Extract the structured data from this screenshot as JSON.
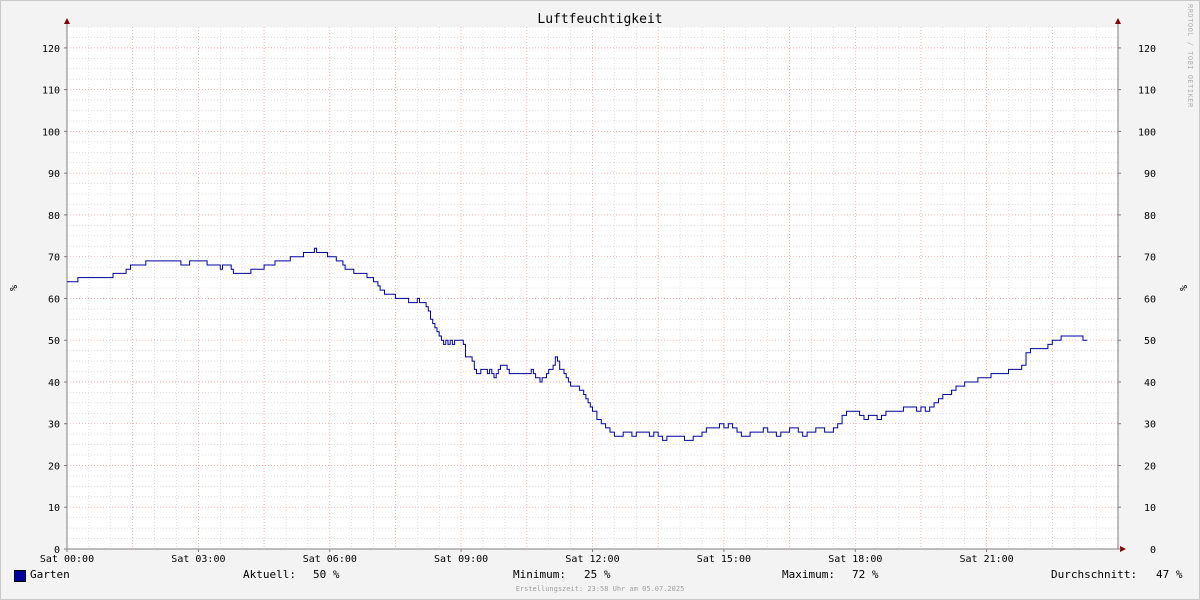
{
  "chart_data": {
    "type": "line",
    "title": "Luftfeuchtigkeit",
    "ylabel": "%",
    "ylim": [
      0,
      125
    ],
    "y_ticks": [
      0,
      10,
      20,
      30,
      40,
      50,
      60,
      70,
      80,
      90,
      100,
      110,
      120
    ],
    "x_tick_labels": [
      "Sat 00:00",
      "Sat 03:00",
      "Sat 06:00",
      "Sat 09:00",
      "Sat 12:00",
      "Sat 15:00",
      "Sat 18:00",
      "Sat 21:00"
    ],
    "x_tick_hours": [
      0,
      3,
      6,
      9,
      12,
      15,
      18,
      21
    ],
    "xlim_hours": [
      0,
      24
    ],
    "grid": true,
    "colors": {
      "series": "#0000a0",
      "major_grid": "#f0a0a0",
      "minor_grid": "#d0d0d0",
      "axis": "#800000"
    },
    "series": [
      {
        "name": "Garten",
        "x_hours": [
          0,
          0.2,
          0.25,
          0.6,
          1.0,
          1.05,
          1.3,
          1.35,
          1.45,
          1.75,
          1.8,
          2.3,
          2.55,
          2.6,
          2.75,
          2.8,
          3.15,
          3.2,
          3.35,
          3.45,
          3.5,
          3.55,
          3.75,
          3.8,
          4.2,
          4.25,
          4.5,
          4.55,
          4.75,
          4.8,
          5.1,
          5.15,
          5.4,
          5.45,
          5.65,
          5.7,
          5.9,
          5.95,
          6.15,
          6.2,
          6.3,
          6.35,
          6.5,
          6.55,
          6.65,
          6.7,
          6.85,
          6.9,
          7.0,
          7.05,
          7.1,
          7.15,
          7.25,
          7.35,
          7.45,
          7.5,
          7.6,
          7.65,
          7.75,
          7.8,
          8.0,
          8.05,
          8.15,
          8.2,
          8.25,
          8.3,
          8.35,
          8.4,
          8.45,
          8.5,
          8.55,
          8.6,
          8.65,
          8.7,
          8.75,
          8.8,
          8.85,
          8.9,
          8.95,
          9.0,
          9.05,
          9.1,
          9.15,
          9.2,
          9.25,
          9.3,
          9.35,
          9.4,
          9.45,
          9.5,
          9.55,
          9.6,
          9.65,
          9.7,
          9.75,
          9.8,
          9.85,
          9.9,
          9.95,
          10.0,
          10.05,
          10.1,
          10.15,
          10.2,
          10.25,
          10.3,
          10.35,
          10.4,
          10.45,
          10.5,
          10.55,
          10.6,
          10.65,
          10.7,
          10.75,
          10.8,
          10.85,
          10.9,
          10.95,
          11.0,
          11.05,
          11.1,
          11.15,
          11.2,
          11.25,
          11.3,
          11.35,
          11.4,
          11.45,
          11.5,
          11.55,
          11.6,
          11.65,
          11.7,
          11.75,
          11.8,
          11.85,
          11.9,
          11.95,
          12.0,
          12.1,
          12.2,
          12.3,
          12.4,
          12.5,
          12.6,
          12.7,
          12.8,
          12.9,
          13.0,
          13.1,
          13.2,
          13.3,
          13.4,
          13.5,
          13.6,
          13.7,
          13.8,
          13.9,
          14.0,
          14.1,
          14.2,
          14.3,
          14.4,
          14.5,
          14.6,
          14.7,
          14.8,
          14.9,
          15.0,
          15.1,
          15.2,
          15.3,
          15.4,
          15.5,
          15.6,
          15.7,
          15.8,
          15.9,
          16.0,
          16.1,
          16.2,
          16.3,
          16.4,
          16.5,
          16.6,
          16.7,
          16.8,
          16.9,
          17.0,
          17.1,
          17.2,
          17.3,
          17.4,
          17.5,
          17.6,
          17.7,
          17.8,
          17.9,
          18.0,
          18.1,
          18.2,
          18.3,
          18.4,
          18.5,
          18.6,
          18.7,
          18.8,
          18.9,
          19.0,
          19.1,
          19.2,
          19.3,
          19.4,
          19.5,
          19.6,
          19.7,
          19.8,
          19.9,
          20.0,
          20.1,
          20.2,
          20.3,
          20.4,
          20.5,
          20.6,
          20.7,
          20.8,
          20.9,
          21.0,
          21.1,
          21.2,
          21.3,
          21.4,
          21.5,
          21.6,
          21.7,
          21.8,
          21.9,
          22.0,
          22.1,
          22.2,
          22.3,
          22.4,
          22.5,
          22.6,
          22.7,
          22.8,
          22.9,
          23.0,
          23.1,
          23.2,
          23.3,
          23.4,
          23.5,
          23.6,
          23.7,
          23.8,
          23.9,
          24.0
        ],
        "values": [
          64,
          64,
          65,
          65,
          65,
          66,
          66,
          67,
          68,
          68,
          69,
          69,
          69,
          68,
          68,
          69,
          69,
          68,
          68,
          68,
          67,
          68,
          67,
          66,
          67,
          67,
          68,
          68,
          69,
          69,
          70,
          70,
          71,
          71,
          72,
          71,
          71,
          70,
          69,
          69,
          68,
          67,
          67,
          66,
          66,
          66,
          65,
          65,
          64,
          64,
          63,
          62,
          61,
          61,
          61,
          60,
          60,
          60,
          60,
          59,
          60,
          59,
          59,
          58,
          57,
          55,
          54,
          53,
          52,
          51,
          50,
          49,
          50,
          49,
          50,
          49,
          50,
          50,
          50,
          50,
          49,
          46,
          46,
          46,
          45,
          43,
          42,
          42,
          43,
          43,
          43,
          42,
          43,
          42,
          41,
          42,
          43,
          44,
          44,
          44,
          43,
          42,
          42,
          42,
          42,
          42,
          42,
          42,
          42,
          42,
          42,
          43,
          42,
          41,
          41,
          40,
          41,
          41,
          42,
          43,
          43,
          44,
          46,
          45,
          43,
          43,
          42,
          41,
          40,
          39,
          39,
          39,
          39,
          38,
          38,
          37,
          36,
          35,
          34,
          33,
          31,
          30,
          29,
          28,
          27,
          27,
          28,
          28,
          27,
          28,
          28,
          28,
          27,
          28,
          27,
          26,
          27,
          27,
          27,
          27,
          26,
          26,
          27,
          27,
          28,
          29,
          29,
          29,
          30,
          29,
          30,
          29,
          28,
          27,
          27,
          28,
          28,
          28,
          29,
          28,
          28,
          27,
          28,
          28,
          29,
          29,
          28,
          27,
          28,
          28,
          29,
          29,
          28,
          28,
          29,
          30,
          32,
          33,
          33,
          33,
          32,
          31,
          32,
          32,
          31,
          32,
          33,
          33,
          33,
          33,
          34,
          34,
          34,
          33,
          34,
          33,
          34,
          35,
          36,
          37,
          37,
          38,
          39,
          39,
          40,
          40,
          40,
          41,
          41,
          41,
          42,
          42,
          42,
          42,
          43,
          43,
          43,
          44,
          47,
          48,
          48,
          48,
          48,
          49,
          50,
          50,
          51,
          51,
          51,
          51,
          51,
          50
        ]
      }
    ],
    "legend": {
      "series_name": "Garten",
      "current_label": "Aktuell:",
      "current_value": "50 %",
      "min_label": "Minimum:",
      "min_value": "25 %",
      "max_label": "Maximum:",
      "max_value": "72 %",
      "avg_label": "Durchschnitt:",
      "avg_value": "47 %"
    },
    "created": "Erstellungszeit: 23:58 Uhr am 05.07.2025",
    "watermark": "RRDTOOL / TOBI OETIKER"
  }
}
